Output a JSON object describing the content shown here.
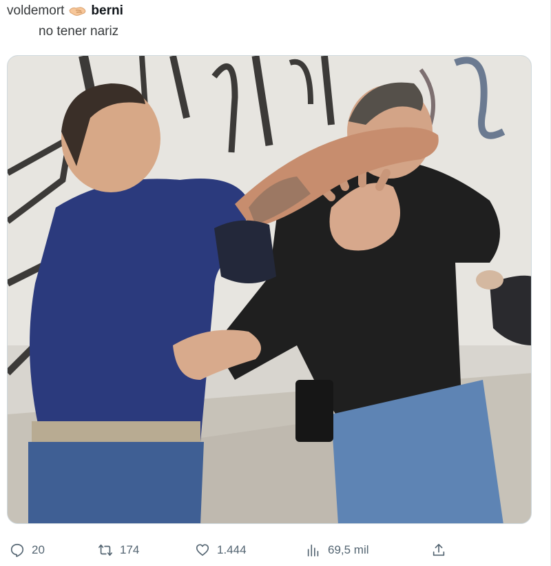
{
  "tweet": {
    "subject": "voldemort",
    "handshake_icon": "handshake-emoji",
    "object": "berni",
    "caption": "no tener nariz"
  },
  "media": {
    "description_icon": "photo"
  },
  "actions": {
    "reply": {
      "icon": "reply-icon",
      "count": "20"
    },
    "retweet": {
      "icon": "retweet-icon",
      "count": "174"
    },
    "like": {
      "icon": "heart-icon",
      "count": "1.444"
    },
    "views": {
      "icon": "views-icon",
      "count": "69,5 mil"
    },
    "share": {
      "icon": "share-icon"
    }
  },
  "colors": {
    "text": "#0f1419",
    "secondary": "#536471",
    "border": "#cfd9de"
  }
}
